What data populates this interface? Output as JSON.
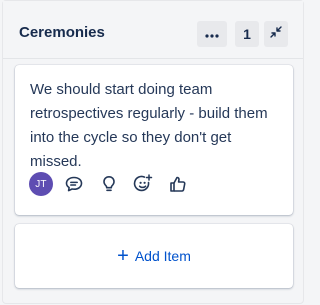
{
  "column": {
    "title": "Ceremonies",
    "more_icon": "more-icon",
    "count": "1",
    "collapse_icon": "collapse-icon"
  },
  "card": {
    "text": "We should start doing team retrospectives regularly - build them into the cycle so they don't get missed.",
    "avatar_initials": "JT",
    "actions": [
      "comment-icon",
      "idea-icon",
      "emoji-icon",
      "like-icon"
    ]
  },
  "add_item": {
    "icon": "plus-icon",
    "label": "Add Item"
  },
  "colors": {
    "background": "#f4f5f7",
    "card": "#ffffff",
    "text": "#253858",
    "avatar": "#5e4db2",
    "link": "#0052cc"
  }
}
